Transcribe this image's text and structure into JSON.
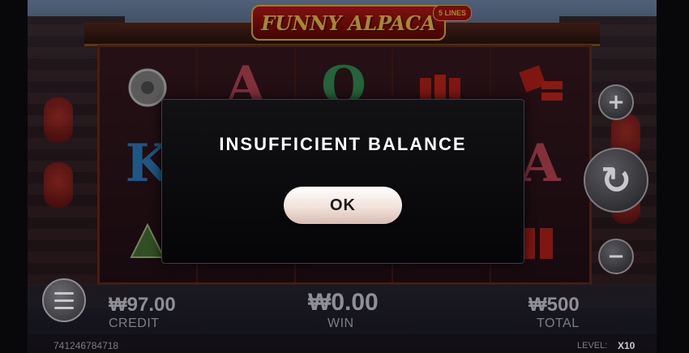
{
  "game": {
    "title": "FUNNY ALPACA",
    "lines_badge": "5 LINES"
  },
  "reels": [
    [
      "",
      "K",
      ""
    ],
    [
      "A",
      "",
      ""
    ],
    [
      "Q",
      "",
      ""
    ],
    [
      "",
      "",
      ""
    ],
    [
      "",
      "A",
      ""
    ]
  ],
  "dialog": {
    "message": "INSUFFICIENT BALANCE",
    "ok_label": "OK"
  },
  "stats": {
    "credit_value": "₩97.00",
    "credit_label": "CREDIT",
    "win_value": "₩0.00",
    "win_label": "WIN",
    "total_value": "₩500",
    "total_label": "TOTAL"
  },
  "controls": {
    "plus_glyph": "+",
    "minus_glyph": "−",
    "spin_glyph": "↻"
  },
  "footer": {
    "round_id": "741246784718",
    "level_label": "LEVEL:",
    "level_value": "X10"
  },
  "colors": {
    "accent_gold": "#ffd24a",
    "brand_red": "#c51a1a",
    "dialog_bg": "#0a0a0c"
  }
}
